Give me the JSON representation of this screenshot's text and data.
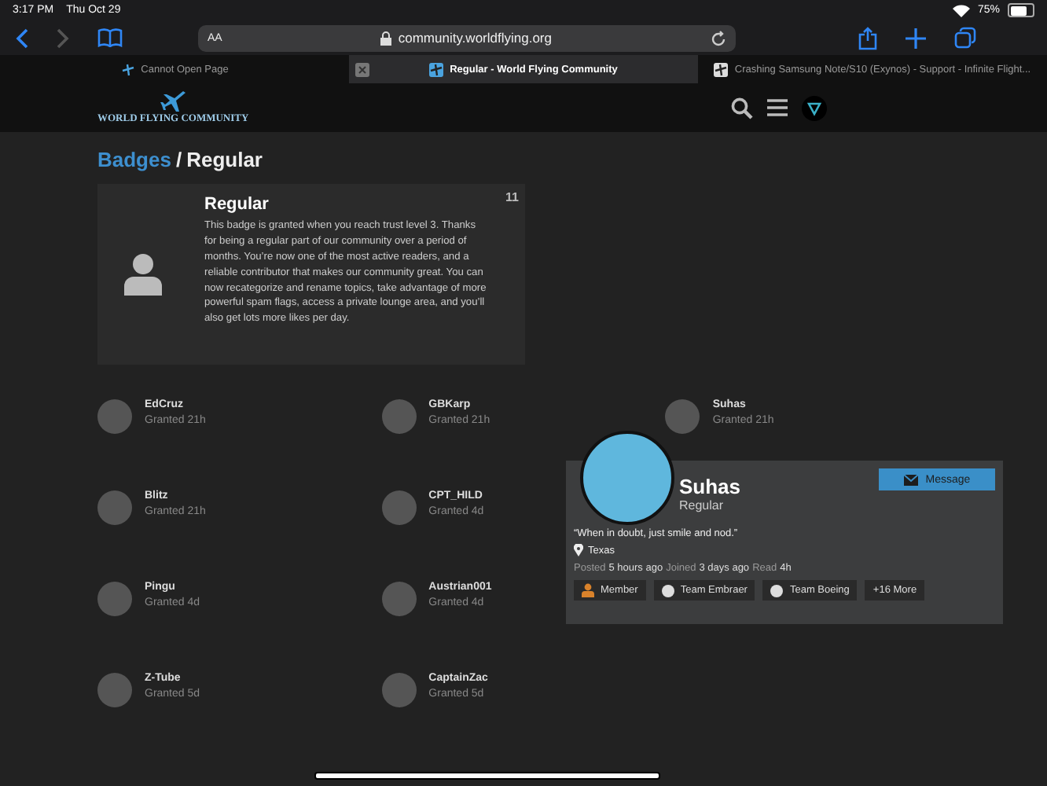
{
  "status_bar": {
    "time": "3:17 PM",
    "date": "Thu Oct 29",
    "battery": "75%"
  },
  "browser": {
    "text_size_button": "AA",
    "address": "community.worldflying.org",
    "tabs": [
      {
        "title": "Cannot Open Page",
        "selected": false
      },
      {
        "title": "Regular - World Flying Community",
        "selected": true
      },
      {
        "title": "Crashing Samsung Note/S10 (Exynos) - Support - Infinite Flight...",
        "selected": false
      }
    ]
  },
  "site_header": {
    "logo_text": "WORLD FLYING COMMUNITY"
  },
  "breadcrumb": {
    "parent": "Badges",
    "separator": "/",
    "current": "Regular"
  },
  "badge": {
    "title": "Regular",
    "count": "11",
    "description": "This badge is granted when you reach trust level 3. Thanks for being a regular part of our community over a period of months. You’re now one of the most active readers, and a reliable contributor that makes our community great. You can now recategorize and rename topics, take advantage of more powerful spam flags, access a private lounge area, and you’ll also get lots more likes per day."
  },
  "grantees": [
    {
      "name": "EdCruz",
      "granted": "Granted 21h"
    },
    {
      "name": "GBKarp",
      "granted": "Granted 21h"
    },
    {
      "name": "Suhas",
      "granted": "Granted 21h"
    },
    {
      "name": "Blitz",
      "granted": "Granted 21h"
    },
    {
      "name": "CPT_HILD",
      "granted": "Granted 4d"
    },
    {
      "name": "Pingu",
      "granted": "Granted 4d"
    },
    {
      "name": "Austrian001",
      "granted": "Granted 4d"
    },
    {
      "name": "Z-Tube",
      "granted": "Granted 5d"
    },
    {
      "name": "CaptainZac",
      "granted": "Granted 5d"
    }
  ],
  "user_card": {
    "name": "Suhas",
    "title": "Regular",
    "button": "Message",
    "bio": "“When in doubt, just smile and nod.”",
    "location": "Texas",
    "stats": [
      {
        "label": "Posted",
        "value": "5 hours ago"
      },
      {
        "label": "Joined",
        "value": "3 days ago"
      },
      {
        "label": "Read",
        "value": "4h"
      }
    ],
    "groups": [
      {
        "label": "Member",
        "kind": "member"
      },
      {
        "label": "Team Embraer",
        "kind": "team"
      },
      {
        "label": "Team Boeing",
        "kind": "team"
      },
      {
        "label": "+16 More",
        "kind": "more"
      }
    ]
  }
}
